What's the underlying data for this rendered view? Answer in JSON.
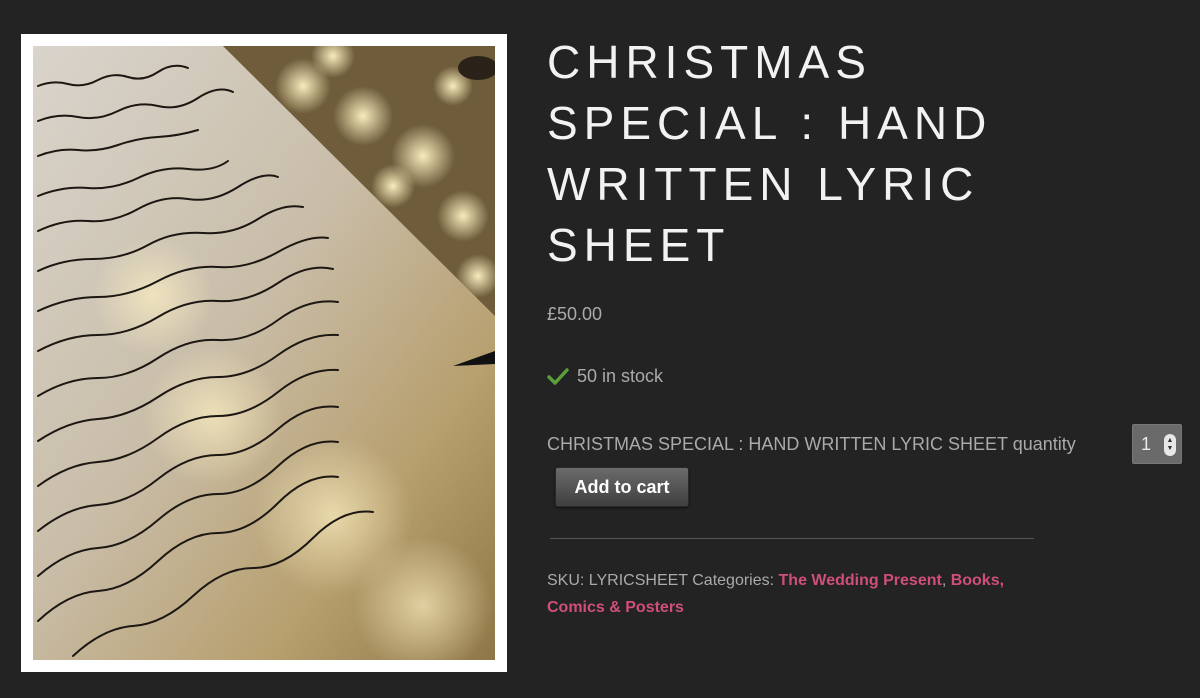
{
  "product": {
    "title": "CHRISTMAS SPECIAL : HAND WRITTEN LYRIC SHEET",
    "price": "£50.00",
    "stock": "50 in stock",
    "quantity_label": "CHRISTMAS SPECIAL : HAND WRITTEN LYRIC SHEET quantity",
    "quantity_value": "1",
    "add_to_cart_label": "Add to cart",
    "sku_label": "SKU:",
    "sku_value": "LYRICSHEET",
    "categories_label": "Categories:",
    "categories": [
      "The Wedding Present",
      "Books, Comics & Posters"
    ],
    "category_separator": ", "
  },
  "icons": {
    "stock": "check-icon",
    "quantity": "spinner-icon"
  },
  "colors": {
    "background": "#232323",
    "title": "#f2f2f2",
    "text": "#aaaaaa",
    "link": "#d04f78",
    "check": "#5a9e3a"
  }
}
